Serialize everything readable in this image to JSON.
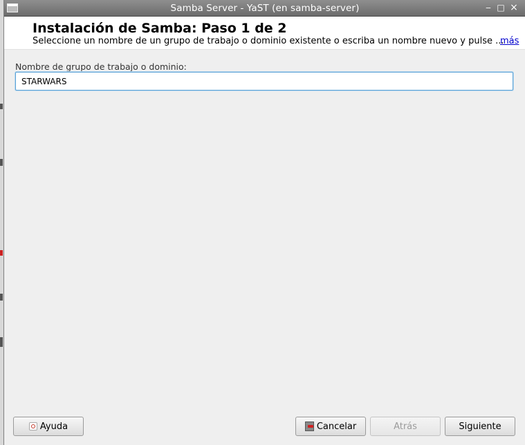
{
  "window": {
    "title": "Samba Server - YaST (en samba-server)",
    "controls": {
      "minimize": "‒",
      "maximize": "□",
      "close": "×"
    }
  },
  "header": {
    "title": "Instalación de Samba: Paso 1 de 2",
    "description": "Seleccione un nombre de un grupo de trabajo o dominio existente o escriba un nombre nuevo y pulse ...",
    "more_link": "más"
  },
  "form": {
    "workgroup_label": "Nombre de grupo de trabajo o dominio:",
    "workgroup_value": "STARWARS"
  },
  "buttons": {
    "help": "Ayuda",
    "cancel": "Cancelar",
    "back": "Atrás",
    "next": "Siguiente"
  },
  "colors": {
    "titlebar": "#7c7c7c",
    "input_focus_border": "#5aa2d6",
    "link": "#0000cc"
  }
}
